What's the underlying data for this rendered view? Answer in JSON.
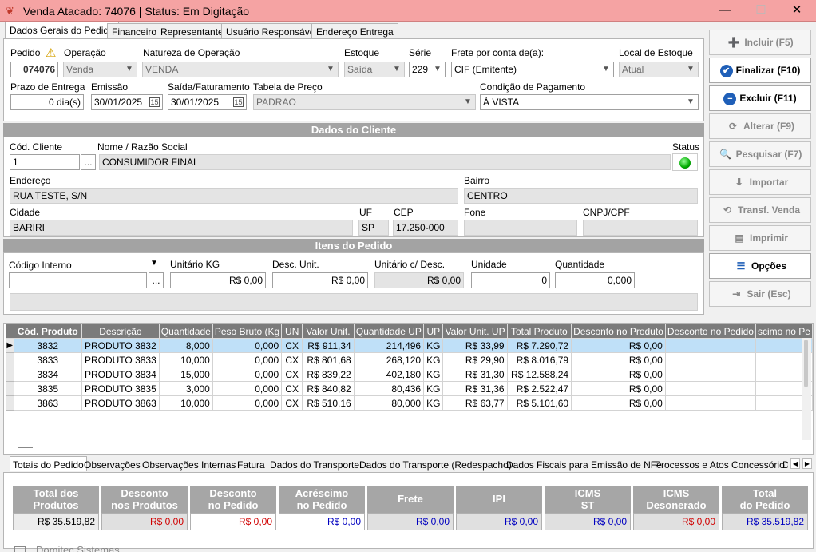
{
  "window": {
    "title": "Venda Atacado: 74076 | Status: Em Digitação",
    "min": "—",
    "max": "☐",
    "close": "✕"
  },
  "tabs": [
    "Dados Gerais do Pedido",
    "Financeiro",
    "Representante",
    "Usuário Responsável",
    "Endereço Entrega"
  ],
  "header": {
    "pedido_label": "Pedido",
    "pedido_value": "074076",
    "operacao_label": "Operação",
    "operacao_value": "Venda",
    "natureza_label": "Natureza de Operação",
    "natureza_value": "VENDA",
    "estoque_label": "Estoque",
    "estoque_value": "Saída",
    "serie_label": "Série",
    "serie_value": "229",
    "frete_label": "Frete por conta de(a):",
    "frete_value": "CIF (Emitente)",
    "local_label": "Local de Estoque",
    "local_value": "Atual",
    "prazo_label": "Prazo de Entrega",
    "prazo_value": "0 dia(s)",
    "emissao_label": "Emissão",
    "emissao_value": "30/01/2025",
    "saida_label": "Saída/Faturamento",
    "saida_value": "30/01/2025",
    "tabela_label": "Tabela de Preço",
    "tabela_value": "PADRAO",
    "condicao_label": "Condição de Pagamento",
    "condicao_value": "À VISTA"
  },
  "cliente": {
    "section_title": "Dados do Cliente",
    "cod_label": "Cód. Cliente",
    "cod_value": "1",
    "cod_btn": "...",
    "nome_label": "Nome / Razão Social",
    "nome_value": "CONSUMIDOR FINAL",
    "status_label": "Status",
    "endereco_label": "Endereço",
    "endereco_value": "RUA TESTE, S/N",
    "bairro_label": "Bairro",
    "bairro_value": "CENTRO",
    "cidade_label": "Cidade",
    "cidade_value": "BARIRI",
    "uf_label": "UF",
    "uf_value": "SP",
    "cep_label": "CEP",
    "cep_value": "17.250-000",
    "fone_label": "Fone",
    "fone_value": "",
    "cnpj_label": "CNPJ/CPF",
    "cnpj_value": ""
  },
  "itens": {
    "section_title": "Itens do Pedido",
    "codigo_label": "Código Interno",
    "codigo_value": "",
    "codigo_btn": "...",
    "unitario_label": "Unitário KG",
    "unitario_value": "R$ 0,00",
    "desc_label": "Desc. Unit.",
    "desc_value": "R$ 0,00",
    "unit_desc_label": "Unitário c/ Desc.",
    "unit_desc_value": "R$ 0,00",
    "unidade_label": "Unidade",
    "unidade_value": "0",
    "quantidade_label": "Quantidade",
    "quantidade_value": "0,000"
  },
  "side_buttons": [
    {
      "label": "Incluir (F5)",
      "icon": "➕",
      "on": false
    },
    {
      "label": "Finalizar (F10)",
      "icon": "✔",
      "on": true
    },
    {
      "label": "Excluir (F11)",
      "icon": "−",
      "on": true
    },
    {
      "label": "Alterar (F9)",
      "icon": "⟳",
      "on": false
    },
    {
      "label": "Pesquisar (F7)",
      "icon": "🔍",
      "on": false
    },
    {
      "label": "Importar",
      "icon": "⬇",
      "on": false
    },
    {
      "label": "Transf. Venda",
      "icon": "⟲",
      "on": false
    },
    {
      "label": "Imprimir",
      "icon": "▤",
      "on": false
    },
    {
      "label": "Opções",
      "icon": "☰",
      "on": true
    },
    {
      "label": "Sair (Esc)",
      "icon": "⇥",
      "on": false
    }
  ],
  "grid": {
    "columns": [
      "Cód. Produto",
      "Descrição",
      "Quantidade",
      "Peso Bruto (Kg",
      "UN",
      "Valor Unit.",
      "Quantidade UP",
      "UP",
      "Valor Unit. UP",
      "Total Produto",
      "Desconto no Produto",
      "Desconto no Pedido",
      "scimo no Pe"
    ],
    "rows": [
      [
        "3832",
        "PRODUTO 3832",
        "8,000",
        "0,000",
        "CX",
        "R$ 911,34",
        "214,496",
        "KG",
        "R$ 33,99",
        "R$ 7.290,72",
        "R$ 0,00",
        "",
        ""
      ],
      [
        "3833",
        "PRODUTO 3833",
        "10,000",
        "0,000",
        "CX",
        "R$ 801,68",
        "268,120",
        "KG",
        "R$ 29,90",
        "R$ 8.016,79",
        "R$ 0,00",
        "",
        ""
      ],
      [
        "3834",
        "PRODUTO 3834",
        "15,000",
        "0,000",
        "CX",
        "R$ 839,22",
        "402,180",
        "KG",
        "R$ 31,30",
        "R$ 12.588,24",
        "R$ 0,00",
        "",
        ""
      ],
      [
        "3835",
        "PRODUTO 3835",
        "3,000",
        "0,000",
        "CX",
        "R$ 840,82",
        "80,436",
        "KG",
        "R$ 31,36",
        "R$ 2.522,47",
        "R$ 0,00",
        "",
        ""
      ],
      [
        "3863",
        "PRODUTO 3863",
        "10,000",
        "0,000",
        "CX",
        "R$ 510,16",
        "80,000",
        "KG",
        "R$ 63,77",
        "R$ 5.101,60",
        "R$ 0,00",
        "",
        ""
      ]
    ]
  },
  "bottom_tabs": [
    "Totais do Pedido",
    "Observações",
    "Observações Internas",
    "Fatura",
    "Dados do Transporte",
    "Dados do Transporte (Redespacho)",
    "Dados Fiscais para Emissão de NFe",
    "Processos e Atos Concessório",
    "D"
  ],
  "totals": [
    {
      "l1": "Total dos",
      "l2": "Produtos",
      "value": "R$ 35.519,82",
      "color": "#000000",
      "bg": "#ececec"
    },
    {
      "l1": "Desconto",
      "l2": "nos Produtos",
      "value": "R$ 0,00",
      "color": "#d00000",
      "bg": "#e0e0e0"
    },
    {
      "l1": "Desconto",
      "l2": "no Pedido",
      "value": "R$ 0,00",
      "color": "#d00000",
      "bg": "#ffffff"
    },
    {
      "l1": "Acréscimo",
      "l2": "no Pedido",
      "value": "R$ 0,00",
      "color": "#0000c0",
      "bg": "#ffffff"
    },
    {
      "l1": "Frete",
      "l2": "",
      "value": "R$ 0,00",
      "color": "#0000c0",
      "bg": "#e0e0e0"
    },
    {
      "l1": "IPI",
      "l2": "",
      "value": "R$ 0,00",
      "color": "#0000c0",
      "bg": "#e0e0e0"
    },
    {
      "l1": "ICMS",
      "l2": "ST",
      "value": "R$ 0,00",
      "color": "#0000c0",
      "bg": "#e0e0e0"
    },
    {
      "l1": "ICMS",
      "l2": "Desonerado",
      "value": "R$ 0,00",
      "color": "#d00000",
      "bg": "#e0e0e0"
    },
    {
      "l1": "Total",
      "l2": "do Pedido",
      "value": "R$ 35.519,82",
      "color": "#0000c0",
      "bg": "#e0e0e0"
    }
  ],
  "footer": {
    "text": "Domitec Sistemas"
  }
}
